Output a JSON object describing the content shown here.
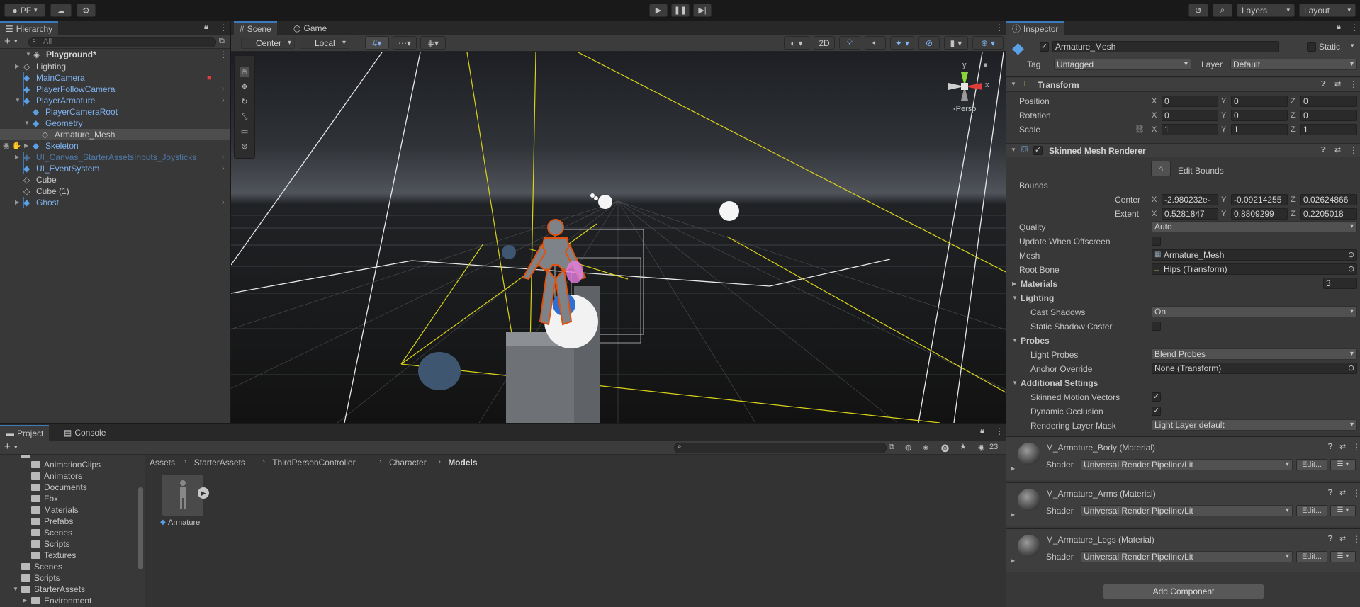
{
  "toolbar": {
    "account": "PF",
    "layers": "Layers",
    "layout": "Layout"
  },
  "hierarchy": {
    "tab": "Hierarchy",
    "search_placeholder": "All",
    "scene": "Playground*",
    "items": [
      {
        "label": "Lighting",
        "color": "white"
      },
      {
        "label": "MainCamera",
        "color": "blue"
      },
      {
        "label": "PlayerFollowCamera",
        "color": "blue"
      },
      {
        "label": "PlayerArmature",
        "color": "blue"
      },
      {
        "label": "PlayerCameraRoot",
        "color": "blue"
      },
      {
        "label": "Geometry",
        "color": "blue"
      },
      {
        "label": "Armature_Mesh",
        "color": "white"
      },
      {
        "label": "Skeleton",
        "color": "blue"
      },
      {
        "label": "UI_Canvas_StarterAssetsInputs_Joysticks",
        "color": "dim"
      },
      {
        "label": "UI_EventSystem",
        "color": "blue"
      },
      {
        "label": "Cube",
        "color": "white"
      },
      {
        "label": "Cube (1)",
        "color": "white"
      },
      {
        "label": "Ghost",
        "color": "blue"
      }
    ]
  },
  "scene_view": {
    "tabs": [
      "Scene",
      "Game"
    ],
    "pivot": "Center",
    "space": "Local",
    "mode_2d": "2D",
    "gizmo_axes": {
      "x": "x",
      "y": "y"
    },
    "persp": "‹Persp"
  },
  "inspector": {
    "tab": "Inspector",
    "object_name": "Armature_Mesh",
    "static_label": "Static",
    "tag_label": "Tag",
    "tag_value": "Untagged",
    "layer_label": "Layer",
    "layer_value": "Default",
    "transform": {
      "title": "Transform",
      "position": {
        "label": "Position",
        "x": "0",
        "y": "0",
        "z": "0"
      },
      "rotation": {
        "label": "Rotation",
        "x": "0",
        "y": "0",
        "z": "0"
      },
      "scale": {
        "label": "Scale",
        "x": "1",
        "y": "1",
        "z": "1"
      }
    },
    "smr": {
      "title": "Skinned Mesh Renderer",
      "edit_bounds": "Edit Bounds",
      "bounds_label": "Bounds",
      "center": {
        "label": "Center",
        "x": "-2.980232e-",
        "y": "-0.09214255",
        "z": "0.02624866"
      },
      "extent": {
        "label": "Extent",
        "x": "0.5281847",
        "y": "0.8809299",
        "z": "0.2205018"
      },
      "quality_label": "Quality",
      "quality": "Auto",
      "update_offscreen": "Update When Offscreen",
      "mesh_label": "Mesh",
      "mesh": "Armature_Mesh",
      "root_bone_label": "Root Bone",
      "root_bone": "Hips (Transform)",
      "materials_label": "Materials",
      "materials_count": "3",
      "lighting_label": "Lighting",
      "cast_shadows_label": "Cast Shadows",
      "cast_shadows": "On",
      "static_shadow_label": "Static Shadow Caster",
      "probes_label": "Probes",
      "light_probes_label": "Light Probes",
      "light_probes": "Blend Probes",
      "anchor_label": "Anchor Override",
      "anchor": "None (Transform)",
      "additional_label": "Additional Settings",
      "motion_vectors_label": "Skinned Motion Vectors",
      "dynamic_occlusion_label": "Dynamic Occlusion",
      "rendering_layer_label": "Rendering Layer Mask",
      "rendering_layer": "Light Layer default"
    },
    "materials": [
      {
        "name": "M_Armature_Body (Material)",
        "shader_label": "Shader",
        "shader": "Universal Render Pipeline/Lit",
        "edit": "Edit..."
      },
      {
        "name": "M_Armature_Arms (Material)",
        "shader_label": "Shader",
        "shader": "Universal Render Pipeline/Lit",
        "edit": "Edit..."
      },
      {
        "name": "M_Armature_Legs (Material)",
        "shader_label": "Shader",
        "shader": "Universal Render Pipeline/Lit",
        "edit": "Edit..."
      }
    ],
    "add_component": "Add Component"
  },
  "project": {
    "tabs": [
      "Project",
      "Console"
    ],
    "hidden_count": "23",
    "breadcrumb": [
      "Assets",
      "StarterAssets",
      "ThirdPersonController",
      "Character",
      "Models"
    ],
    "folders": [
      {
        "label": "AnimationClips",
        "indent": 2
      },
      {
        "label": "Animators",
        "indent": 2
      },
      {
        "label": "Documents",
        "indent": 2
      },
      {
        "label": "Fbx",
        "indent": 2
      },
      {
        "label": "Materials",
        "indent": 2
      },
      {
        "label": "Prefabs",
        "indent": 2
      },
      {
        "label": "Scenes",
        "indent": 2
      },
      {
        "label": "Scripts",
        "indent": 2
      },
      {
        "label": "Textures",
        "indent": 2
      },
      {
        "label": "Scenes",
        "indent": 1
      },
      {
        "label": "Scripts",
        "indent": 1
      },
      {
        "label": "StarterAssets",
        "indent": 1
      },
      {
        "label": "Environment",
        "indent": 2
      }
    ],
    "asset": "Armature"
  }
}
